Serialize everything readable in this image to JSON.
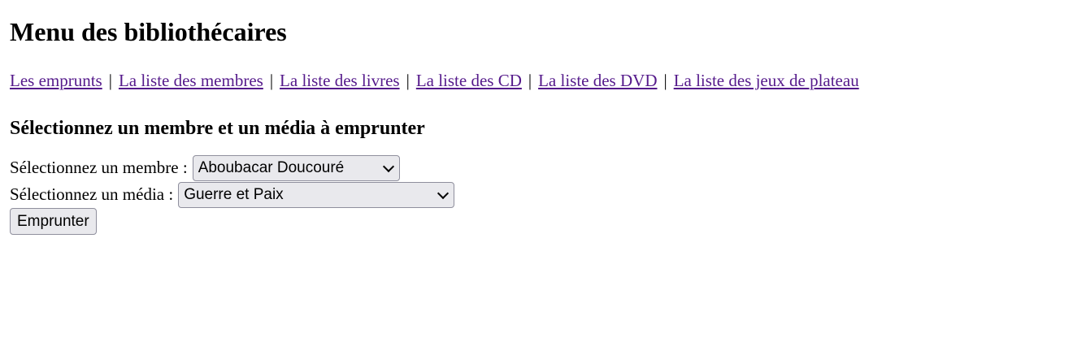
{
  "page": {
    "title": "Menu des bibliothécaires"
  },
  "nav": {
    "links": [
      {
        "label": "Les emprunts"
      },
      {
        "label": "La liste des membres"
      },
      {
        "label": "La liste des livres"
      },
      {
        "label": "La liste des CD"
      },
      {
        "label": "La liste des DVD"
      },
      {
        "label": "La liste des jeux de plateau"
      }
    ],
    "separator": "|",
    "link_color": "#551a8b"
  },
  "form": {
    "heading": "Sélectionnez un membre et un média à emprunter",
    "member_label": "Sélectionnez un membre :",
    "member_selected": "Aboubacar Doucouré",
    "media_label": "Sélectionnez un média :",
    "media_selected": "Guerre et Paix",
    "submit_label": "Emprunter"
  }
}
